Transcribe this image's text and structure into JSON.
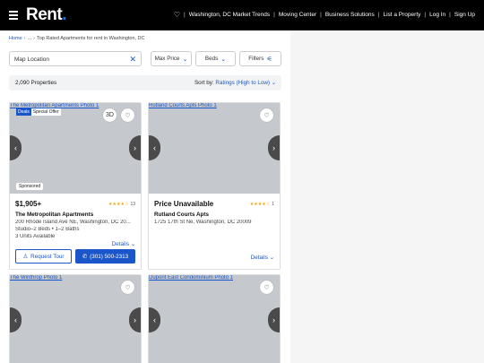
{
  "header": {
    "logo": "Rent",
    "logo_dot": ".",
    "nav": [
      "Washington, DC Market Trends",
      "Moving Center",
      "Business Solutions",
      "List a Property",
      "Log In",
      "Sign Up"
    ]
  },
  "breadcrumb": [
    "Home",
    "...",
    "Top Rated Apartments for rent in Washington, DC"
  ],
  "search": {
    "value": "Map Location"
  },
  "filters": {
    "max_price": "Max Price",
    "beds": "Beds",
    "filters": "Filters"
  },
  "results": {
    "count": "2,090 Properties",
    "sort_label": "Sort by:",
    "sort_value": "Ratings (High to Low)"
  },
  "listings": [
    {
      "photo_alt": "The Metropolitan Apartments Photo 1",
      "deals": "Deals",
      "special": "Special Offer",
      "sponsored": "Sponsored",
      "price": "$1,905+",
      "name": "The Metropolitan Apartments",
      "address": "200 Rhode Island Ave NE, Washington, DC 20...",
      "beds": "Studio–2 Beds • 1–2 Baths",
      "units": "3 Units Available",
      "details": "Details",
      "tour": "Request Tour",
      "phone": "(301) 500-2313",
      "reviews": "13",
      "rating": 4
    },
    {
      "photo_alt": "Rutland Courts Apts Photo 1",
      "price": "Price Unavailable",
      "name": "Rutland Courts Apts",
      "address": "1725 17th St Ne, Washington, DC 20009",
      "details": "Details",
      "reviews": "1",
      "rating": 4
    },
    {
      "photo_alt": "The Winthrop Photo 1"
    },
    {
      "photo_alt": "Dupont East Condominium Photo 1"
    }
  ],
  "colors": {
    "accent": "#1a56c9",
    "header": "#000000",
    "star": "#f1a20d"
  }
}
